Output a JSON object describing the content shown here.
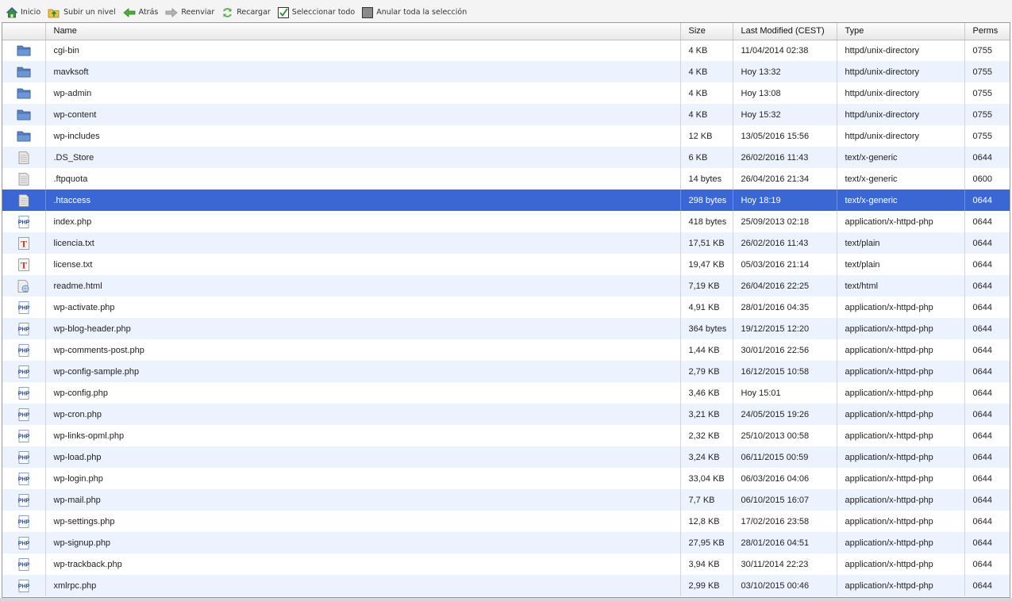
{
  "toolbar": {
    "home": "Inicio",
    "up": "Subir un nivel",
    "back": "Atrás",
    "forward": "Reenviar",
    "reload": "Recargar",
    "select_all": "Seleccionar todo",
    "deselect_all": "Anular toda la selección"
  },
  "columns": {
    "name": "Name",
    "size": "Size",
    "modified": "Last Modified (CEST)",
    "type": "Type",
    "perms": "Perms"
  },
  "files": [
    {
      "icon": "folder-icon",
      "name": "cgi-bin",
      "size": "4 KB",
      "modified": "11/04/2014 02:38",
      "type": "httpd/unix-directory",
      "perms": "0755"
    },
    {
      "icon": "folder-icon",
      "name": "mavksoft",
      "size": "4 KB",
      "modified": "Hoy 13:32",
      "type": "httpd/unix-directory",
      "perms": "0755"
    },
    {
      "icon": "folder-icon",
      "name": "wp-admin",
      "size": "4 KB",
      "modified": "Hoy 13:08",
      "type": "httpd/unix-directory",
      "perms": "0755"
    },
    {
      "icon": "folder-icon",
      "name": "wp-content",
      "size": "4 KB",
      "modified": "Hoy 15:32",
      "type": "httpd/unix-directory",
      "perms": "0755"
    },
    {
      "icon": "folder-icon",
      "name": "wp-includes",
      "size": "12 KB",
      "modified": "13/05/2016 15:56",
      "type": "httpd/unix-directory",
      "perms": "0755"
    },
    {
      "icon": "generic-file-icon",
      "name": ".DS_Store",
      "size": "6 KB",
      "modified": "26/02/2016 11:43",
      "type": "text/x-generic",
      "perms": "0644"
    },
    {
      "icon": "generic-file-icon",
      "name": ".ftpquota",
      "size": "14 bytes",
      "modified": "26/04/2016 21:34",
      "type": "text/x-generic",
      "perms": "0600"
    },
    {
      "icon": "generic-file-icon",
      "name": ".htaccess",
      "size": "298 bytes",
      "modified": "Hoy 18:19",
      "type": "text/x-generic",
      "perms": "0644",
      "selected": true
    },
    {
      "icon": "php-file-icon",
      "name": "index.php",
      "size": "418 bytes",
      "modified": "25/09/2013 02:18",
      "type": "application/x-httpd-php",
      "perms": "0644"
    },
    {
      "icon": "text-file-icon",
      "name": "licencia.txt",
      "size": "17,51 KB",
      "modified": "26/02/2016 11:43",
      "type": "text/plain",
      "perms": "0644"
    },
    {
      "icon": "text-file-icon",
      "name": "license.txt",
      "size": "19,47 KB",
      "modified": "05/03/2016 21:14",
      "type": "text/plain",
      "perms": "0644"
    },
    {
      "icon": "html-file-icon",
      "name": "readme.html",
      "size": "7,19 KB",
      "modified": "26/04/2016 22:25",
      "type": "text/html",
      "perms": "0644"
    },
    {
      "icon": "php-file-icon",
      "name": "wp-activate.php",
      "size": "4,91 KB",
      "modified": "28/01/2016 04:35",
      "type": "application/x-httpd-php",
      "perms": "0644"
    },
    {
      "icon": "php-file-icon",
      "name": "wp-blog-header.php",
      "size": "364 bytes",
      "modified": "19/12/2015 12:20",
      "type": "application/x-httpd-php",
      "perms": "0644"
    },
    {
      "icon": "php-file-icon",
      "name": "wp-comments-post.php",
      "size": "1,44 KB",
      "modified": "30/01/2016 22:56",
      "type": "application/x-httpd-php",
      "perms": "0644"
    },
    {
      "icon": "php-file-icon",
      "name": "wp-config-sample.php",
      "size": "2,79 KB",
      "modified": "16/12/2015 10:58",
      "type": "application/x-httpd-php",
      "perms": "0644"
    },
    {
      "icon": "php-file-icon",
      "name": "wp-config.php",
      "size": "3,46 KB",
      "modified": "Hoy 15:01",
      "type": "application/x-httpd-php",
      "perms": "0644"
    },
    {
      "icon": "php-file-icon",
      "name": "wp-cron.php",
      "size": "3,21 KB",
      "modified": "24/05/2015 19:26",
      "type": "application/x-httpd-php",
      "perms": "0644"
    },
    {
      "icon": "php-file-icon",
      "name": "wp-links-opml.php",
      "size": "2,32 KB",
      "modified": "25/10/2013 00:58",
      "type": "application/x-httpd-php",
      "perms": "0644"
    },
    {
      "icon": "php-file-icon",
      "name": "wp-load.php",
      "size": "3,24 KB",
      "modified": "06/11/2015 00:59",
      "type": "application/x-httpd-php",
      "perms": "0644"
    },
    {
      "icon": "php-file-icon",
      "name": "wp-login.php",
      "size": "33,04 KB",
      "modified": "06/03/2016 04:06",
      "type": "application/x-httpd-php",
      "perms": "0644"
    },
    {
      "icon": "php-file-icon",
      "name": "wp-mail.php",
      "size": "7,7 KB",
      "modified": "06/10/2015 16:07",
      "type": "application/x-httpd-php",
      "perms": "0644"
    },
    {
      "icon": "php-file-icon",
      "name": "wp-settings.php",
      "size": "12,8 KB",
      "modified": "17/02/2016 23:58",
      "type": "application/x-httpd-php",
      "perms": "0644"
    },
    {
      "icon": "php-file-icon",
      "name": "wp-signup.php",
      "size": "27,95 KB",
      "modified": "28/01/2016 04:51",
      "type": "application/x-httpd-php",
      "perms": "0644"
    },
    {
      "icon": "php-file-icon",
      "name": "wp-trackback.php",
      "size": "3,94 KB",
      "modified": "30/11/2014 22:23",
      "type": "application/x-httpd-php",
      "perms": "0644"
    },
    {
      "icon": "php-file-icon",
      "name": "xmlrpc.php",
      "size": "2,99 KB",
      "modified": "03/10/2015 00:46",
      "type": "application/x-httpd-php",
      "perms": "0644"
    }
  ],
  "colors": {
    "selection": "#3a67d4",
    "row_alt": "#edf3fe",
    "folder": "#5b84c4"
  }
}
